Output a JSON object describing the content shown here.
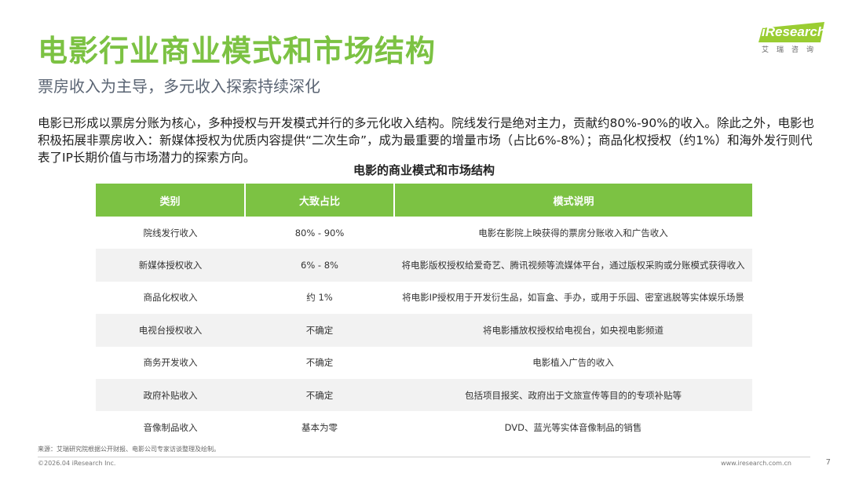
{
  "header": {
    "title": "电影行业商业模式和市场结构",
    "subtitle": "票房收入为主导，多元收入探索持续深化"
  },
  "logo": {
    "brand": "iResearch",
    "sub": "艾瑞咨询",
    "color": "#9acd32"
  },
  "intro": {
    "text": "电影已形成以票房分账为核心，多种授权与开发模式并行的多元化收入结构。院线发行是绝对主力，贡献约80%-90%的收入。除此之外，电影也积极拓展非票房收入：新媒体授权为优质内容提供“二次生命”，成为最重要的增量市场（占比6%-8%）；商品化权授权（约1%）和海外发行则代表了IP长期价值与市场潜力的探索方向。"
  },
  "table": {
    "title": "电影的商业模式和市场结构",
    "header_color": "#7cc243",
    "headers": [
      "类别",
      "大致占比",
      "模式说明"
    ],
    "rows": [
      [
        "院线发行收入",
        "80% - 90%",
        "电影在影院上映获得的票房分账收入和广告收入"
      ],
      [
        "新媒体授权收入",
        "6% - 8%",
        "将电影版权授权给爱奇艺、腾讯视频等流媒体平台，通过版权采购或分账模式获得收入"
      ],
      [
        "商品化权收入",
        "约 1%",
        "将电影IP授权用于开发衍生品，如盲盒、手办，或用于乐园、密室逃脱等实体娱乐场景"
      ],
      [
        "电视台授权收入",
        "不确定",
        "将电影播放权授权给电视台，如央视电影频道"
      ],
      [
        "商务开发收入",
        "不确定",
        "电影植入广告的收入"
      ],
      [
        "政府补贴收入",
        "不确定",
        "包括项目报奖、政府出于文旅宣传等目的的专项补贴等"
      ],
      [
        "音像制品收入",
        "基本为零",
        "DVD、蓝光等实体音像制品的销售"
      ]
    ]
  },
  "footer": {
    "source": "来源：艾瑞研究院根据公开财报、电影公司专家访谈整理及绘制。",
    "copyright": "©2026.04 iResearch Inc.",
    "website": "www.iresearch.com.cn",
    "page": "7"
  }
}
